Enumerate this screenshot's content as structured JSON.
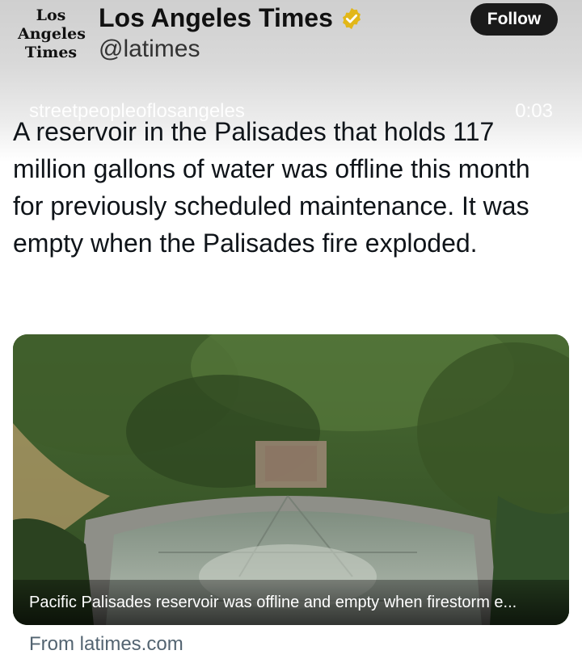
{
  "header": {
    "logo_lines": [
      "Los",
      "Angeles",
      "Times"
    ],
    "account_name": "Los Angeles Times",
    "handle": "@latimes",
    "follow_label": "Follow",
    "badge_icon": "verified-gold-check-icon",
    "badge_color": "#e2b719"
  },
  "video_overlay": {
    "username": "streetpeopleoflosangeles",
    "timestamp": "0:03"
  },
  "tweet": {
    "text": "A reservoir in the Palisades that holds 117 million gallons of water was offline this month for previously scheduled maintenance. It was empty when the Palisades fire exploded."
  },
  "link_card": {
    "caption": "Pacific Palisades reservoir was offline and empty when firestorm e...",
    "source": "From latimes.com"
  }
}
